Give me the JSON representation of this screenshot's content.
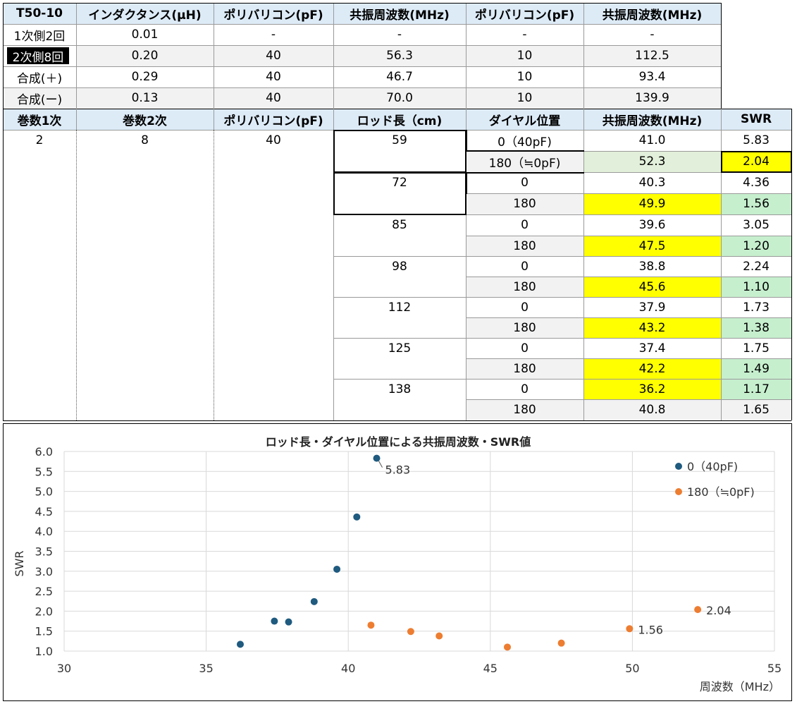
{
  "table1": {
    "headers": [
      "T50-10",
      "インダクタンス(μH)",
      "ポリバリコン(pF)",
      "共振周波数(MHz)",
      "ポリバリコン(pF)",
      "共振周波数(MHz)"
    ],
    "rows": [
      [
        "1次側2回",
        "0.01",
        "-",
        "-",
        "-",
        "-"
      ],
      [
        "2次側8回",
        "0.20",
        "40",
        "56.3",
        "10",
        "112.5"
      ],
      [
        "合成(＋)",
        "0.29",
        "40",
        "46.7",
        "10",
        "93.4"
      ],
      [
        "合成(ー)",
        "0.13",
        "40",
        "70.0",
        "10",
        "139.9"
      ]
    ]
  },
  "table2": {
    "headers": [
      "巻数1次",
      "巻数2次",
      "ポリバリコン(pF)",
      "ロッド長（cm)",
      "ダイヤル位置",
      "共振周波数(MHz)",
      "SWR"
    ],
    "winding1": "2",
    "winding2": "8",
    "capacitor": "40",
    "rods": [
      "59",
      "72",
      "85",
      "98",
      "112",
      "125",
      "138"
    ],
    "rows": [
      [
        "0（40pF)",
        "41.0",
        "5.83"
      ],
      [
        "180（≒0pF)",
        "52.3",
        "2.04"
      ],
      [
        "0",
        "40.3",
        "4.36"
      ],
      [
        "180",
        "49.9",
        "1.56"
      ],
      [
        "0",
        "39.6",
        "3.05"
      ],
      [
        "180",
        "47.5",
        "1.20"
      ],
      [
        "0",
        "38.8",
        "2.24"
      ],
      [
        "180",
        "45.6",
        "1.10"
      ],
      [
        "0",
        "37.9",
        "1.73"
      ],
      [
        "180",
        "43.2",
        "1.38"
      ],
      [
        "0",
        "37.4",
        "1.75"
      ],
      [
        "180",
        "42.2",
        "1.49"
      ],
      [
        "0",
        "36.2",
        "1.17"
      ],
      [
        "180",
        "40.8",
        "1.65"
      ]
    ]
  },
  "chart_data": {
    "type": "scatter",
    "title": "ロッド長・ダイヤル位置による共振周波数・SWR値",
    "xlabel": "周波数（MHz）",
    "ylabel": "SWR",
    "xlim": [
      30,
      55
    ],
    "ylim": [
      1.0,
      6.0
    ],
    "xticks": [
      "30",
      "35",
      "40",
      "45",
      "50",
      "55"
    ],
    "yticks": [
      "1.0",
      "1.5",
      "2.0",
      "2.5",
      "3.0",
      "3.5",
      "4.0",
      "4.5",
      "5.0",
      "5.5",
      "6.0"
    ],
    "grid": true,
    "legend_position": "top-right",
    "series": [
      {
        "name": "0（40pF)",
        "color": "#1f5a7f",
        "points": [
          [
            41.0,
            5.83
          ],
          [
            40.3,
            4.36
          ],
          [
            39.6,
            3.05
          ],
          [
            38.8,
            2.24
          ],
          [
            37.9,
            1.73
          ],
          [
            37.4,
            1.75
          ],
          [
            36.2,
            1.17
          ]
        ],
        "labels": [
          "5.83",
          "",
          "",
          "",
          "",
          "",
          ""
        ]
      },
      {
        "name": "180（≒0pF)",
        "color": "#ed7d31",
        "points": [
          [
            52.3,
            2.04
          ],
          [
            49.9,
            1.56
          ],
          [
            47.5,
            1.2
          ],
          [
            45.6,
            1.1
          ],
          [
            43.2,
            1.38
          ],
          [
            42.2,
            1.49
          ],
          [
            40.8,
            1.65
          ]
        ],
        "labels": [
          "2.04",
          "1.56",
          "",
          "",
          "",
          "",
          ""
        ]
      }
    ]
  }
}
